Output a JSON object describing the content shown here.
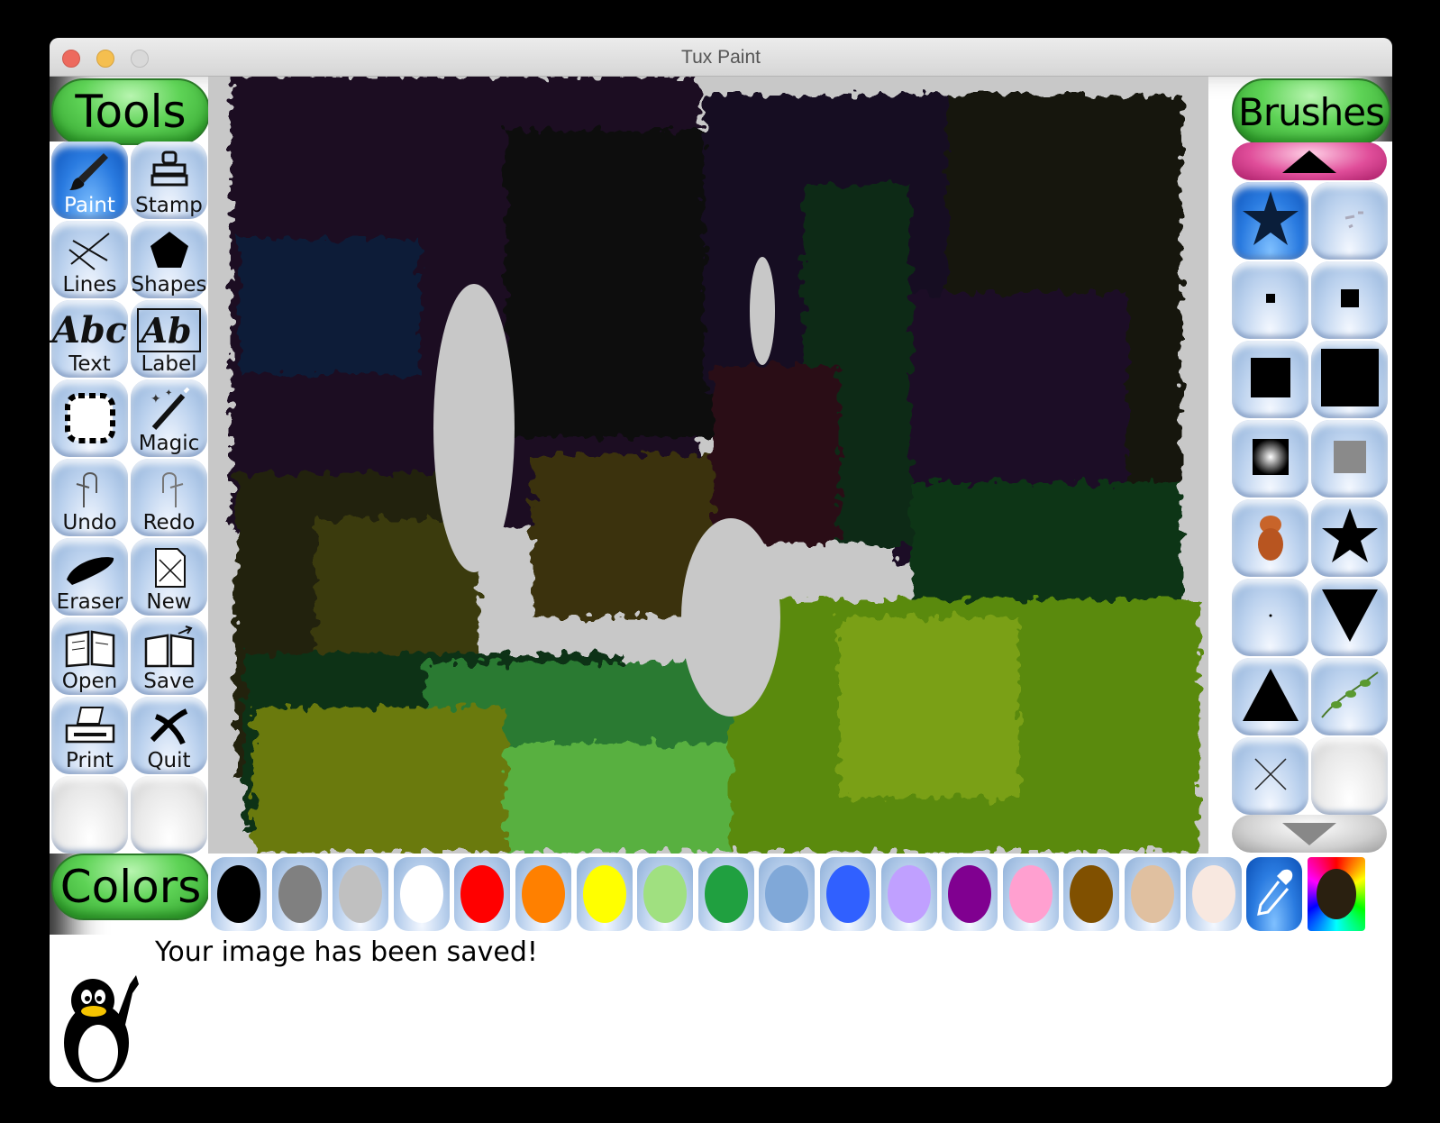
{
  "window": {
    "title": "Tux Paint"
  },
  "sections": {
    "tools": "Tools",
    "brushes": "Brushes",
    "colors": "Colors"
  },
  "tools": [
    {
      "label": "Paint",
      "icon": "paintbrush-icon",
      "selected": true
    },
    {
      "label": "Stamp",
      "icon": "stamp-icon"
    },
    {
      "label": "Lines",
      "icon": "lines-icon"
    },
    {
      "label": "Shapes",
      "icon": "pentagon-icon"
    },
    {
      "label": "Text",
      "icon": "text-icon"
    },
    {
      "label": "Label",
      "icon": "label-icon"
    },
    {
      "label": "",
      "icon": "fill-icon"
    },
    {
      "label": "Magic",
      "icon": "magic-wand-icon"
    },
    {
      "label": "Undo",
      "icon": "undo-icon"
    },
    {
      "label": "Redo",
      "icon": "redo-icon"
    },
    {
      "label": "Eraser",
      "icon": "eraser-icon"
    },
    {
      "label": "New",
      "icon": "new-page-icon"
    },
    {
      "label": "Open",
      "icon": "open-book-icon"
    },
    {
      "label": "Save",
      "icon": "save-book-icon"
    },
    {
      "label": "Print",
      "icon": "printer-icon"
    },
    {
      "label": "Quit",
      "icon": "quit-icon"
    }
  ],
  "tool_icon_text": {
    "text": "Abc",
    "label": "Ab"
  },
  "brushes": [
    {
      "icon": "star-splat-brush-icon",
      "selected": true
    },
    {
      "icon": "speckle-brush-icon"
    },
    {
      "icon": "tiny-square-brush-icon"
    },
    {
      "icon": "small-square-brush-icon"
    },
    {
      "icon": "medium-square-brush-icon"
    },
    {
      "icon": "large-square-brush-icon"
    },
    {
      "icon": "soft-square-brush-icon"
    },
    {
      "icon": "faint-square-brush-icon"
    },
    {
      "icon": "creature-brush-icon"
    },
    {
      "icon": "star-brush-icon"
    },
    {
      "icon": "dot-brush-icon"
    },
    {
      "icon": "down-triangle-brush-icon"
    },
    {
      "icon": "up-triangle-brush-icon"
    },
    {
      "icon": "vine-brush-icon"
    },
    {
      "icon": "x-brush-icon"
    },
    {
      "icon": "blank-brush-icon"
    }
  ],
  "colors": [
    "#000000",
    "#808080",
    "#c0c0c0",
    "#ffffff",
    "#ff0000",
    "#ff8000",
    "#ffff00",
    "#a0e080",
    "#20a040",
    "#80a8d8",
    "#3060ff",
    "#c0a0ff",
    "#800090",
    "#ffa0d0",
    "#805000",
    "#e0c0a0",
    "#f8e8e0"
  ],
  "color_extras": {
    "picker_icon": "eyedropper-icon",
    "custom_color": "#2a2010"
  },
  "status": {
    "message": "Your image has been saved!"
  }
}
